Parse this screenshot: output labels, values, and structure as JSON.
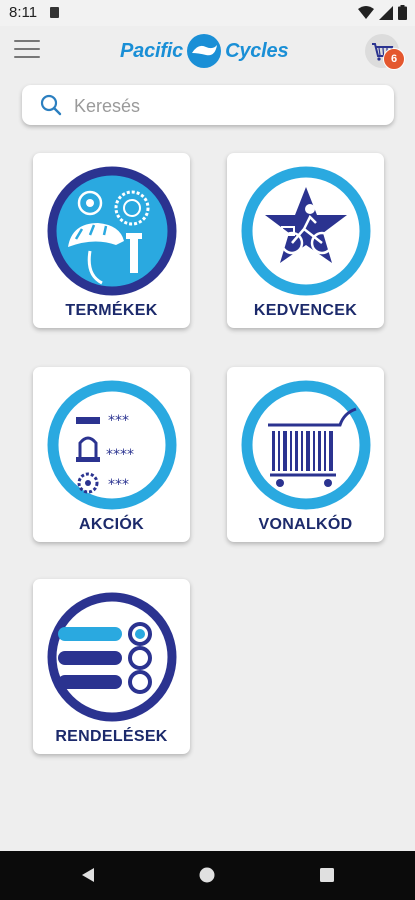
{
  "status_bar": {
    "time": "8:11"
  },
  "app_bar": {
    "logo_left": "Pacific",
    "logo_right": "Cycles",
    "cart_count": "6"
  },
  "search": {
    "placeholder": "Keresés"
  },
  "tiles": [
    {
      "label": "TERMÉKEK",
      "icon": "products-icon"
    },
    {
      "label": "KEDVENCEK",
      "icon": "favorites-icon"
    },
    {
      "label": "AKCIÓK",
      "icon": "promotions-icon"
    },
    {
      "label": "VONALKÓD",
      "icon": "barcode-cart-icon"
    },
    {
      "label": "RENDELÉSEK",
      "icon": "orders-icon"
    }
  ],
  "colors": {
    "dark_blue": "#2b3390",
    "light_blue": "#2aa9e0",
    "label": "#1c2a6b",
    "badge": "#e4572e"
  }
}
